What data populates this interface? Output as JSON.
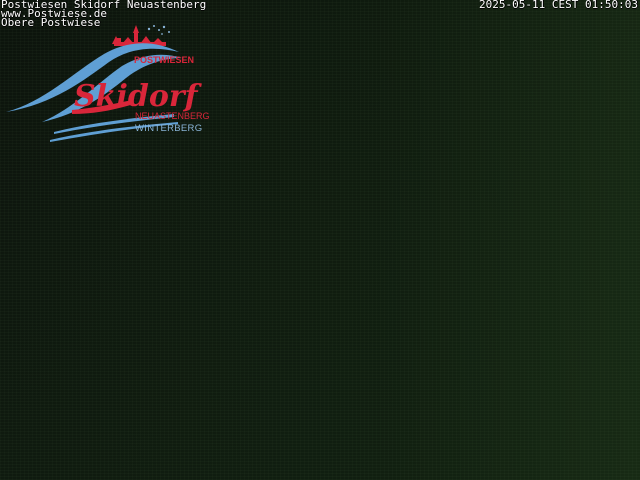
{
  "overlay": {
    "line1": "Postwiesen Skidorf Neuastenberg",
    "line2": "www.Postwiese.de",
    "line3": "Obere Postwiese",
    "timestamp": "2025-05-11 CEST 01:50:03"
  },
  "logo": {
    "top_text": "POSTWIESEN",
    "main_text": "Skidorf",
    "sub_text_1": "NEUASTENBERG",
    "sub_text_2": "WINTERBERG",
    "colors": {
      "red": "#d9263a",
      "blue": "#5f9fd4",
      "light_blue": "#8ab4d8"
    }
  }
}
